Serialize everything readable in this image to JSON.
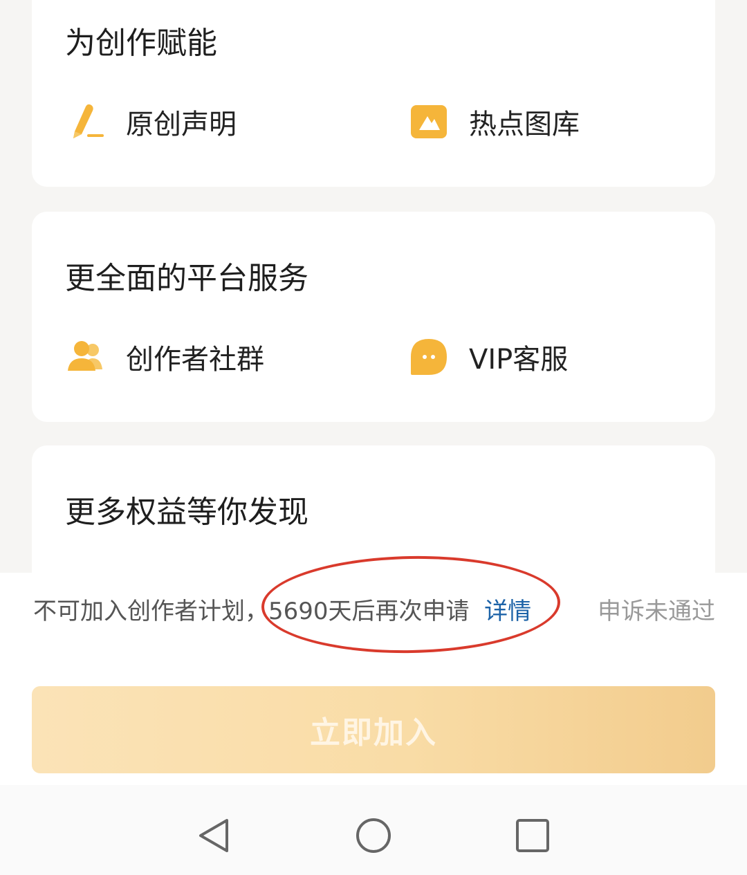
{
  "sections": [
    {
      "title": "为创作赋能",
      "items": [
        {
          "label": "原创声明",
          "icon": "pen-icon"
        },
        {
          "label": "热点图库",
          "icon": "image-gallery-icon"
        }
      ]
    },
    {
      "title": "更全面的平台服务",
      "items": [
        {
          "label": "创作者社群",
          "icon": "users-icon"
        },
        {
          "label": "VIP客服",
          "icon": "chat-bubble-icon"
        }
      ]
    },
    {
      "title": "更多权益等你发现",
      "items": []
    }
  ],
  "status": {
    "prefix": "不可加入创作者计划，",
    "countdown": "5690天后再次申请",
    "details_link": "详情",
    "appeal": "申诉未通过"
  },
  "join_button": "立即加入",
  "colors": {
    "accent": "#f5b53a",
    "link": "#1d63a8",
    "annotation": "#d93a2c"
  },
  "nav": [
    "back-icon",
    "home-icon",
    "recents-icon"
  ]
}
